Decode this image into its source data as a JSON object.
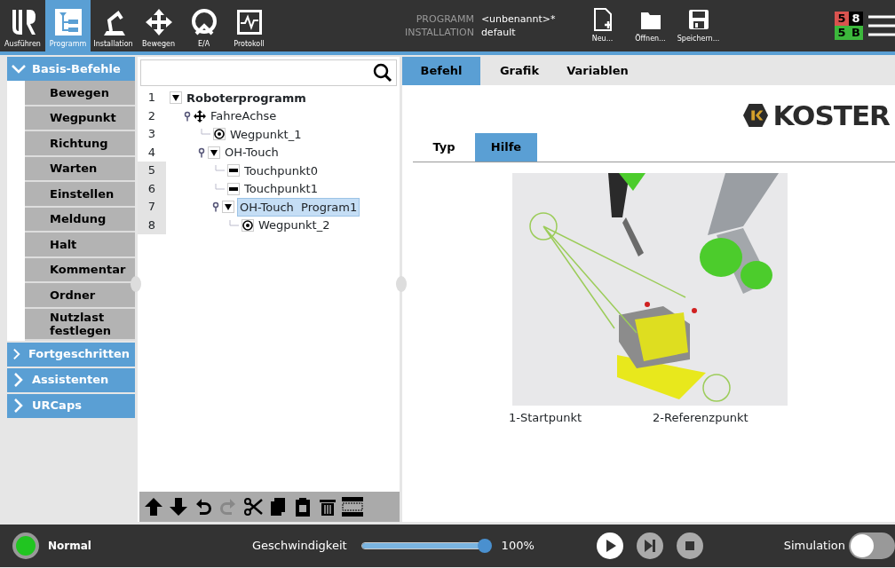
{
  "top_nav": [
    {
      "label": "Ausführen",
      "kind": "logo",
      "selected": false
    },
    {
      "label": "Programm",
      "kind": "program",
      "selected": true
    },
    {
      "label": "Installation",
      "kind": "robot",
      "selected": false
    },
    {
      "label": "Bewegen",
      "kind": "move",
      "selected": false
    },
    {
      "label": "E/A",
      "kind": "io",
      "selected": false
    },
    {
      "label": "Protokoll",
      "kind": "log",
      "selected": false
    }
  ],
  "file_info": [
    {
      "label": "PROGRAMM",
      "value": "<unbenannt>*"
    },
    {
      "label": "INSTALLATION",
      "value": "default"
    }
  ],
  "file_buttons": [
    {
      "label": "Neu...",
      "kind": "new"
    },
    {
      "label": "Öffnen...",
      "kind": "open"
    },
    {
      "label": "Speichern...",
      "kind": "save"
    }
  ],
  "counters": [
    {
      "text": "5",
      "color": "#d9534f"
    },
    {
      "text": "8",
      "color": "#000000"
    },
    {
      "text": "5",
      "color": "#3cb83c"
    },
    {
      "text": "B",
      "color": "#3cb83c"
    }
  ],
  "categories": [
    {
      "label": "Basis-Befehle",
      "expanded": true,
      "items": [
        "Bewegen",
        "Wegpunkt",
        "Richtung",
        "Warten",
        "Einstellen",
        "Meldung",
        "Halt",
        "Kommentar",
        "Ordner",
        "Nutzlast festlegen"
      ]
    },
    {
      "label": "Fortgeschritten",
      "expanded": false
    },
    {
      "label": "Assistenten",
      "expanded": false
    },
    {
      "label": "URCaps",
      "expanded": false
    }
  ],
  "tree": [
    {
      "number": "1",
      "label": "Roboterprogramm",
      "kind": "root",
      "expanded": true,
      "selected": false,
      "shaded": false,
      "children": [
        {
          "number": "2",
          "label": "FahreAchse",
          "kind": "move",
          "selected": false,
          "shaded": false,
          "children": [
            {
              "number": "3",
              "label": "Wegpunkt_1",
              "kind": "waypoint",
              "selected": false,
              "shaded": false
            },
            {
              "number": "4",
              "label": "OH-Touch",
              "kind": "group",
              "expanded": true,
              "selected": false,
              "shaded": false,
              "children": [
                {
                  "number": "5",
                  "label": "Touchpunkt0",
                  "kind": "touch",
                  "selected": false,
                  "shaded": true
                },
                {
                  "number": "6",
                  "label": "Touchpunkt1",
                  "kind": "touch",
                  "selected": false,
                  "shaded": true
                },
                {
                  "number": "7",
                  "label": "OH-Touch  Program1",
                  "kind": "group",
                  "expanded": true,
                  "selected": true,
                  "shaded": true,
                  "children": [
                    {
                      "number": "8",
                      "label": "Wegpunkt_2",
                      "kind": "waypoint",
                      "selected": false,
                      "shaded": true
                    }
                  ]
                }
              ]
            }
          ]
        }
      ]
    }
  ],
  "tree_tools": [
    {
      "kind": "up",
      "disabled": false
    },
    {
      "kind": "down",
      "disabled": false
    },
    {
      "kind": "undo",
      "disabled": false
    },
    {
      "kind": "redo",
      "disabled": true
    },
    {
      "kind": "cut",
      "disabled": false
    },
    {
      "kind": "copy",
      "disabled": false
    },
    {
      "kind": "paste",
      "disabled": false
    },
    {
      "kind": "delete",
      "disabled": false
    },
    {
      "kind": "suppress",
      "disabled": false
    }
  ],
  "main_tabs": [
    {
      "label": "Befehl",
      "selected": true
    },
    {
      "label": "Grafik",
      "selected": false
    },
    {
      "label": "Variablen",
      "selected": false
    }
  ],
  "logo": {
    "text": "KOSTER"
  },
  "sub_tabs": [
    {
      "label": "Typ",
      "selected": false
    },
    {
      "label": "Hilfe",
      "selected": true
    }
  ],
  "help": {
    "image": {
      "kind": "picture"
    },
    "captions": [
      "1-Startpunkt",
      "2-Referenzpunkt"
    ]
  },
  "footer": {
    "status": "Normal",
    "speed_label": "Geschwindigkeit",
    "speed": {
      "level": 1.0,
      "reading": "100%"
    },
    "simulation": {
      "label": "Simulation",
      "on": false
    }
  }
}
